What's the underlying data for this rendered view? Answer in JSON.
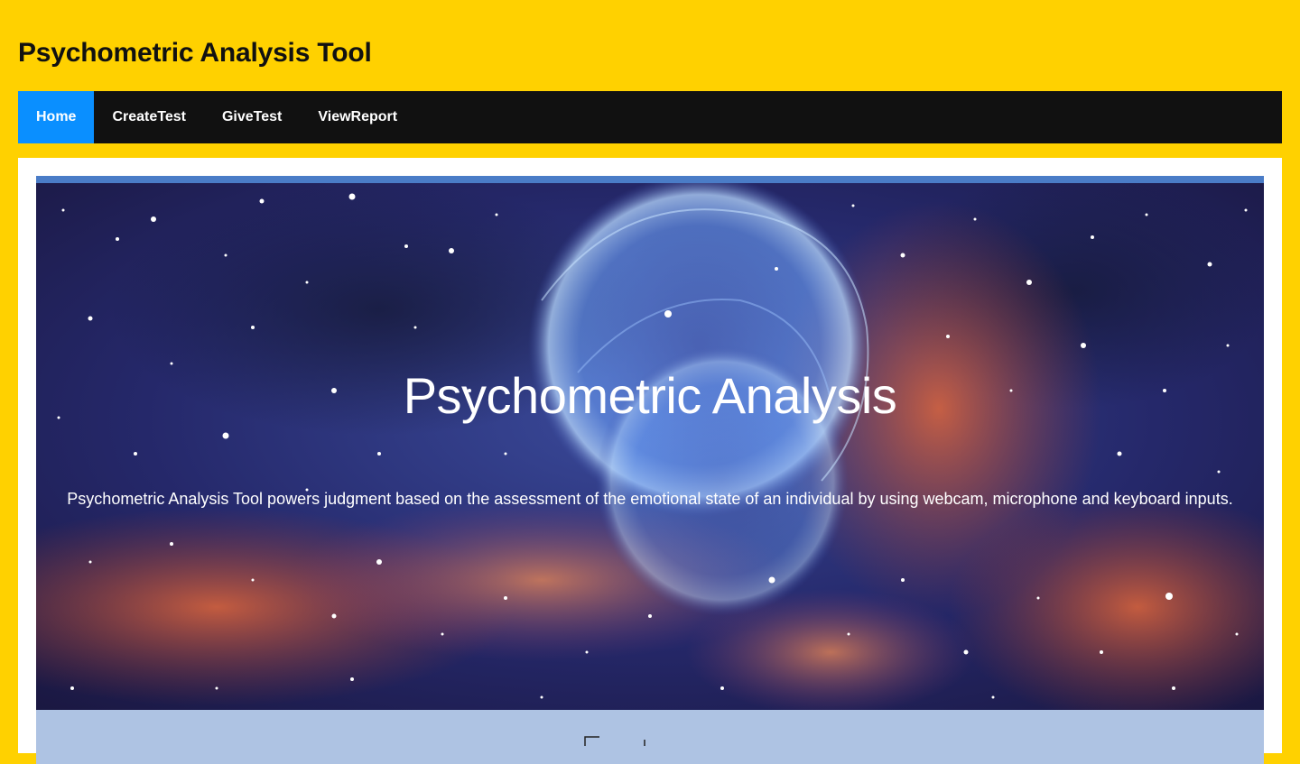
{
  "site": {
    "title": "Psychometric Analysis Tool"
  },
  "nav": {
    "items": [
      {
        "label": "Home",
        "active": true
      },
      {
        "label": "CreateTest",
        "active": false
      },
      {
        "label": "GiveTest",
        "active": false
      },
      {
        "label": "ViewReport",
        "active": false
      }
    ]
  },
  "hero": {
    "title": "Psychometric Analysis",
    "description": "Psychometric Analysis Tool powers judgment based on the assessment of the emotional state of an individual by using webcam, microphone and keyboard inputs.",
    "background": "nebula-image"
  },
  "colors": {
    "page_bg": "#FFD100",
    "navbar_bg": "#111111",
    "nav_active": "#0A8FFF",
    "band": "#AEC3E3"
  }
}
